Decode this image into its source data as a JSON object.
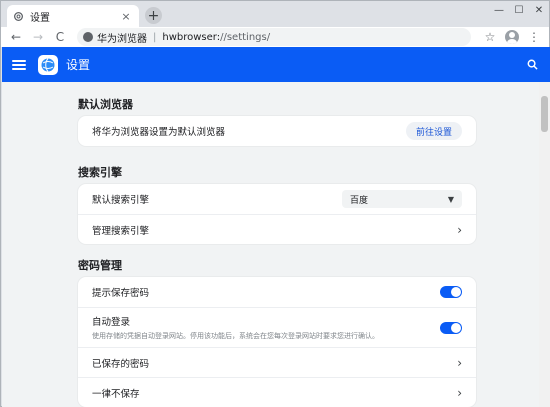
{
  "browser": {
    "tab": {
      "title": "设置",
      "close": "×"
    },
    "new_tab": "+",
    "window_controls": {
      "minimize": "—",
      "maximize": "☐",
      "close": "✕"
    },
    "nav": {
      "back": "←",
      "forward": "→",
      "reload": "C"
    },
    "address": {
      "site_label": "华为浏览器",
      "separator": "|",
      "scheme": "hwbrowser:",
      "path": "//settings/"
    },
    "bookmark_icon": "☆",
    "menu_icon": "⋮"
  },
  "appbar": {
    "title": "设置"
  },
  "sections": {
    "default_browser": {
      "title": "默认浏览器",
      "rows": [
        {
          "label": "将华为浏览器设置为默认浏览器",
          "action": "前往设置"
        }
      ]
    },
    "search_engine": {
      "title": "搜索引擎",
      "rows": [
        {
          "label": "默认搜索引擎",
          "value": "百度"
        },
        {
          "label": "管理搜索引擎"
        }
      ]
    },
    "passwords": {
      "title": "密码管理",
      "rows": [
        {
          "label": "提示保存密码",
          "enabled": true
        },
        {
          "label": "自动登录",
          "sub": "使用存储的凭据自动登录网站。停用该功能后，系统会在您每次登录网站时要求您进行确认。",
          "enabled": true
        },
        {
          "label": "已保存的密码"
        },
        {
          "label": "一律不保存"
        }
      ]
    }
  },
  "colors": {
    "accent": "#0a5cf5",
    "background": "#f1f3f4"
  }
}
